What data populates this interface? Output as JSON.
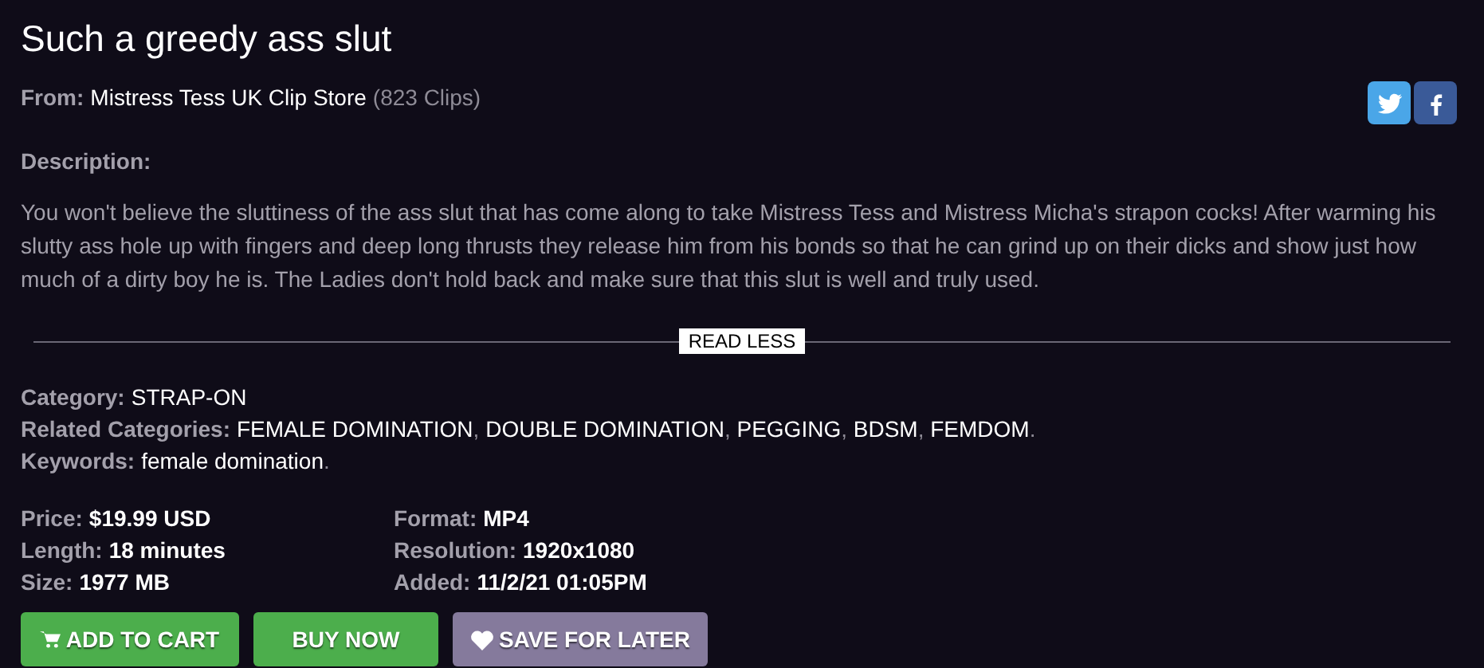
{
  "title": "Such a greedy ass slut",
  "from": {
    "label": "From:",
    "store": "Mistress Tess UK Clip Store",
    "count": "(823 Clips)"
  },
  "share": [
    {
      "kind": "twitter"
    },
    {
      "kind": "facebook"
    }
  ],
  "description": {
    "label": "Description:",
    "text": "You won't believe the sluttiness of the ass slut that has come along to take Mistress Tess and Mistress Micha's strapon cocks! After warming his slutty ass hole up with fingers and deep long thrusts they release him from his bonds so that he can grind up on their dicks and show just how much of a dirty boy he is. The Ladies don't hold back and make sure that this slut is well and truly used."
  },
  "toggle": "READ LESS",
  "categories": [
    {
      "label": "Category:",
      "links": [
        "STRAP-ON"
      ]
    },
    {
      "label": "Related Categories:",
      "links": [
        "FEMALE DOMINATION",
        "DOUBLE DOMINATION",
        "PEGGING",
        "BDSM",
        "FEMDOM"
      ],
      "separator": ", ",
      "end": "."
    },
    {
      "label": "Keywords:",
      "links": [
        "female domination"
      ],
      "end": "."
    }
  ],
  "details": [
    {
      "label": "Price:",
      "value": "$19.99 USD"
    },
    {
      "label": "Length:",
      "value": "18 minutes"
    },
    {
      "label": "Size:",
      "value": "1977 MB"
    },
    {
      "label": "Format:",
      "value": "MP4"
    },
    {
      "label": "Resolution:",
      "value": "1920x1080"
    },
    {
      "label": "Added:",
      "value": "11/2/21 01:05PM"
    }
  ],
  "buttons": [
    {
      "kind": "cart",
      "label": "ADD TO CART"
    },
    {
      "kind": "buy",
      "label": "BUY NOW"
    },
    {
      "kind": "save",
      "label": "SAVE FOR LATER"
    }
  ]
}
